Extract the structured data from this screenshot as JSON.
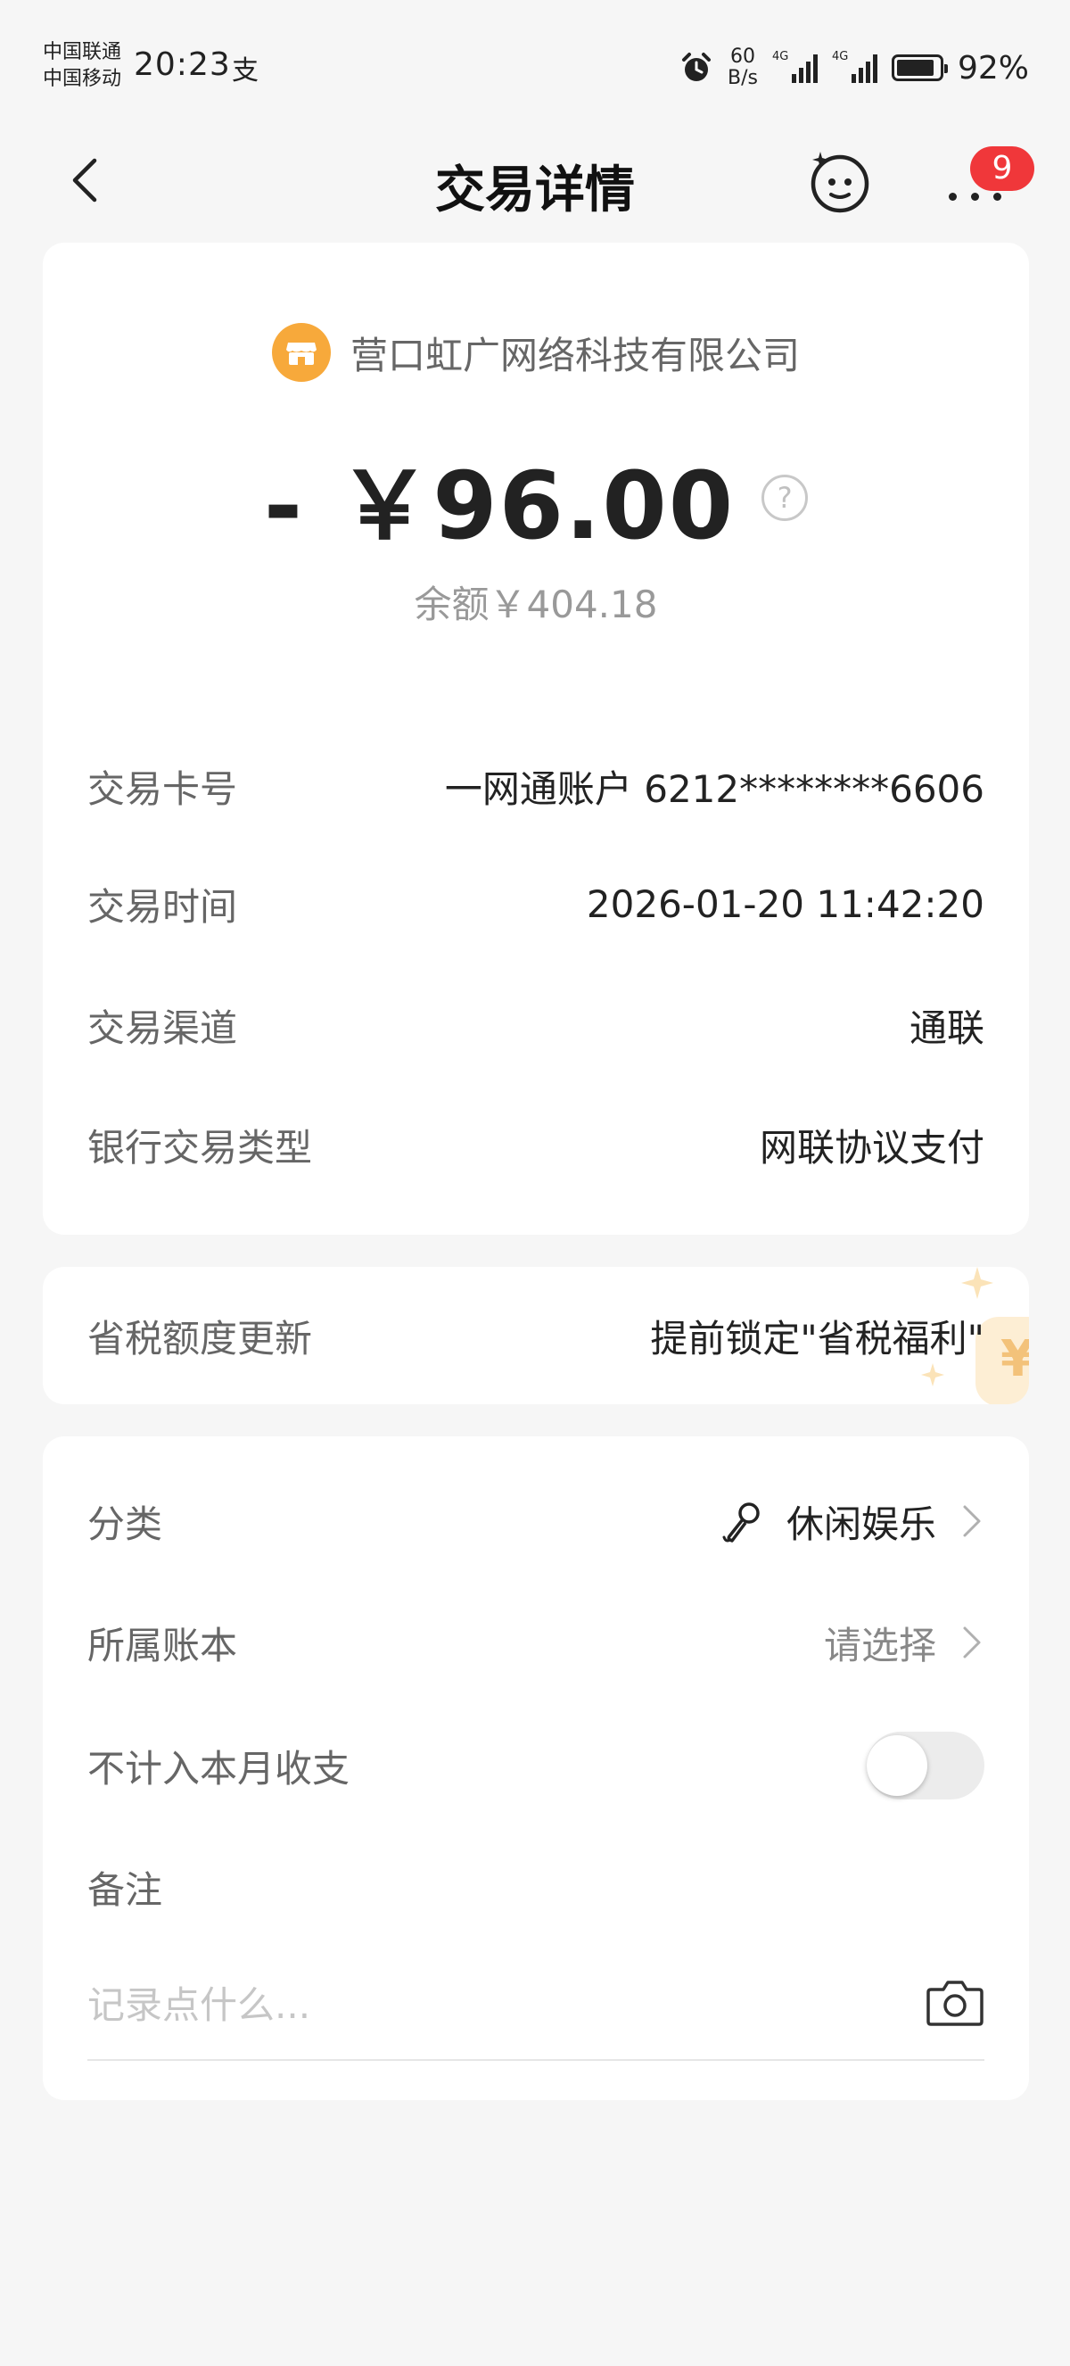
{
  "status_bar": {
    "carrier_1": "中国联通",
    "carrier_2": "中国移动",
    "time": "20:23",
    "pay_indicator": "支",
    "net_speed_value": "60",
    "net_speed_unit": "B/s",
    "signal_1_tag": "4G",
    "signal_2_tag": "4G",
    "battery_percent": "92%"
  },
  "header": {
    "title": "交易详情",
    "notification_count": "9"
  },
  "summary": {
    "merchant": "营口虹广网络科技有限公司",
    "amount": "- ￥96.00",
    "balance": "余额￥404.18",
    "help_symbol": "?"
  },
  "details": [
    {
      "label": "交易卡号",
      "value": "一网通账户 6212********6606"
    },
    {
      "label": "交易时间",
      "value": "2026-01-20 11:42:20"
    },
    {
      "label": "交易渠道",
      "value": "通联"
    },
    {
      "label": "银行交易类型",
      "value": "网联协议支付"
    }
  ],
  "promo": {
    "label": "省税额度更新",
    "value": "提前锁定\"省税福利\""
  },
  "options": {
    "category_label": "分类",
    "category_value": "休闲娱乐",
    "book_label": "所属账本",
    "book_value": "请选择",
    "exclude_label": "不计入本月收支",
    "exclude_enabled": false,
    "memo_label": "备注",
    "memo_placeholder": "记录点什么..."
  },
  "colors": {
    "accent_orange": "#f7a93b",
    "badge_red": "#f0373a",
    "background": "#f6f6f6"
  },
  "icons": [
    "back-arrow-icon",
    "bot-face-icon",
    "more-dots-icon",
    "shop-icon",
    "help-circle-icon",
    "microphone-icon",
    "chevron-right-icon",
    "camera-icon"
  ]
}
